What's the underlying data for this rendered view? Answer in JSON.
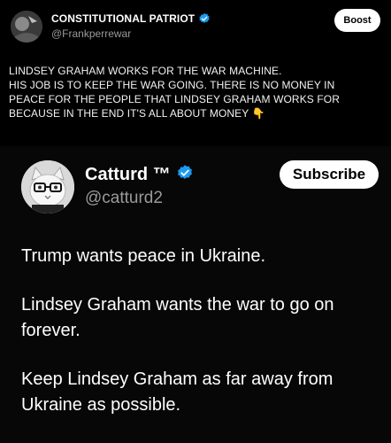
{
  "outer_post": {
    "display_name": "CONSTITUTIONAL PATRIOT",
    "handle": "@Frankperrewar",
    "boost_label": "Boost",
    "text_lines": [
      "LINDSEY GRAHAM WORKS FOR THE WAR MACHINE.",
      " HIS JOB IS TO KEEP THE WAR GOING. THERE IS NO MONEY IN",
      "PEACE FOR THE PEOPLE THAT LINDSEY GRAHAM WORKS FOR",
      "BECAUSE IN THE END IT'S ALL ABOUT MONEY "
    ],
    "emoji": "👇"
  },
  "quoted_post": {
    "display_name": "Catturd ™",
    "handle": "@catturd2",
    "subscribe_label": "Subscribe",
    "paragraphs": [
      [
        "Trump wants peace in Ukraine."
      ],
      [
        "Lindsey Graham wants the war to go on",
        "forever."
      ],
      [
        "Keep Lindsey Graham as far away from",
        "Ukraine as possible."
      ]
    ]
  },
  "colors": {
    "background": "#000000",
    "verified": "#1d9bf0",
    "handle": "#9a9a9a"
  }
}
